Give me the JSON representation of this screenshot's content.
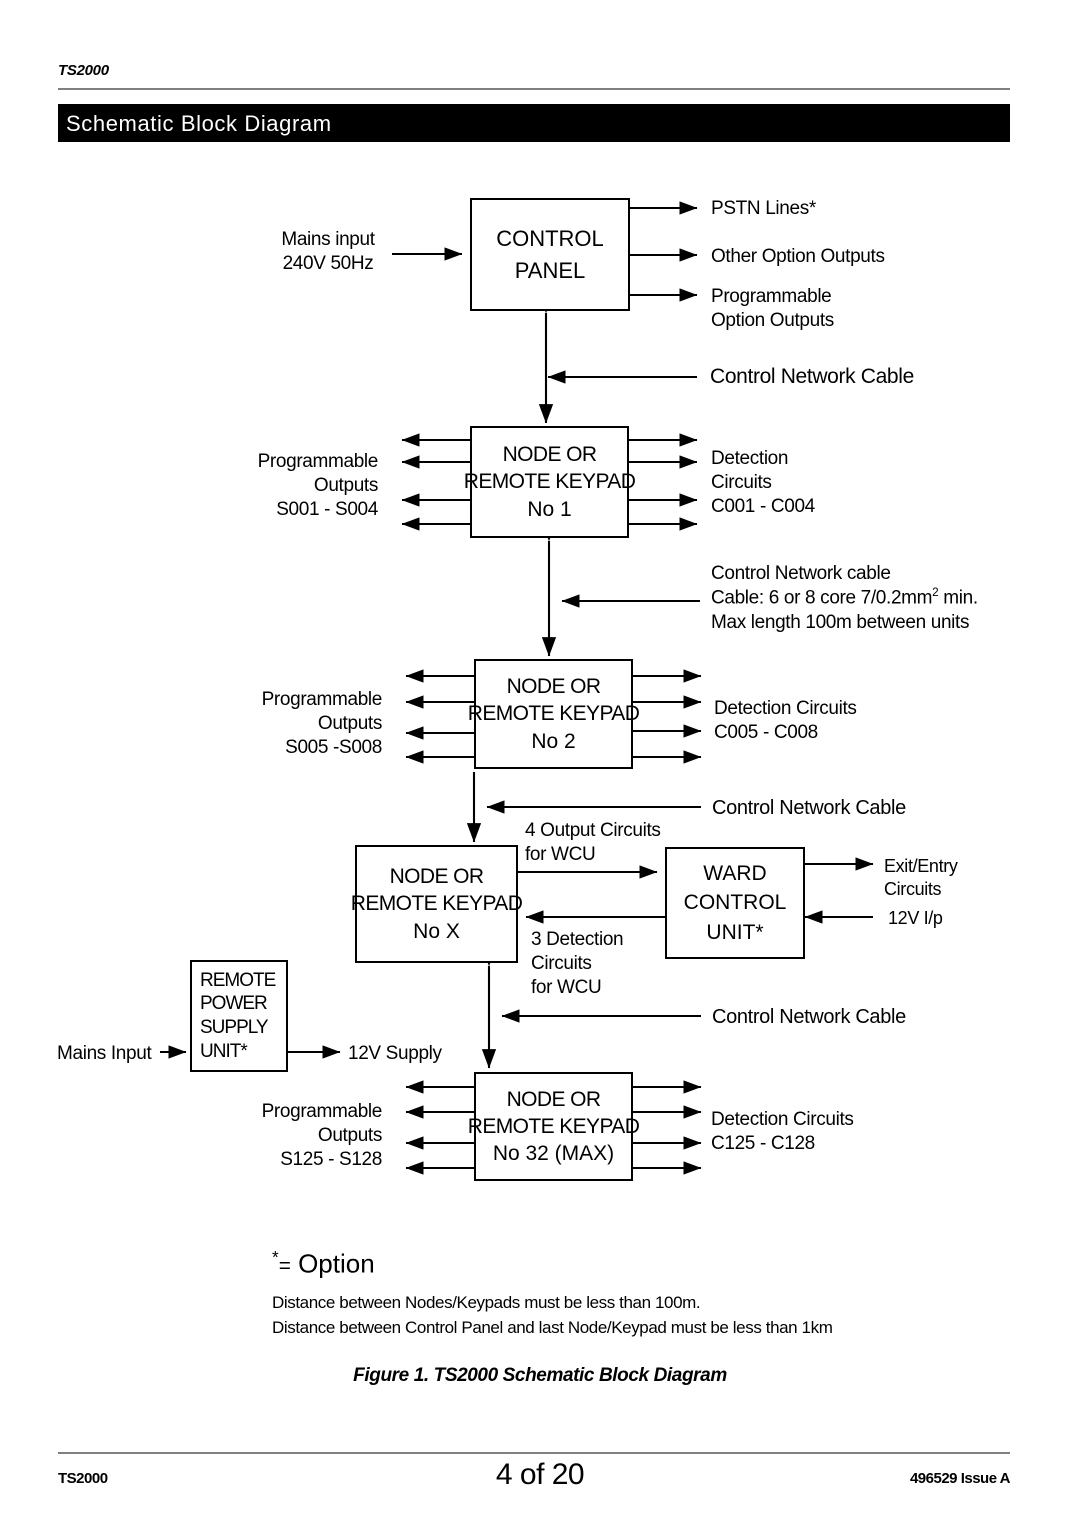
{
  "header": {
    "doc_id": "TS2000",
    "title": "Schematic Block Diagram"
  },
  "blocks": {
    "control_panel": {
      "line1": "CONTROL",
      "line2": "PANEL"
    },
    "node_1": {
      "line1": "NODE OR",
      "line2": "REMOTE KEYPAD",
      "line3": "No  1"
    },
    "node_2": {
      "line1": "NODE OR",
      "line2": "REMOTE KEYPAD",
      "line3": "No  2"
    },
    "node_x": {
      "line1": "NODE OR",
      "line2": "REMOTE KEYPAD",
      "line3": "No  X"
    },
    "node_32": {
      "line1": "NODE OR",
      "line2": "REMOTE KEYPAD",
      "line3": "No 32 (MAX)"
    },
    "ward_control_unit": {
      "line1": "WARD",
      "line2": "CONTROL",
      "line3": "UNIT*"
    },
    "remote_power_supply": {
      "line1": "REMOTE",
      "line2": "POWER",
      "line3": "SUPPLY",
      "line4": "UNIT*"
    }
  },
  "labels": {
    "mains_input_l1": "Mains input",
    "mains_input_l2": "240V 50Hz",
    "pstn_lines": "PSTN Lines*",
    "other_option_outputs": "Other Option Outputs",
    "programmable_option_l1": "Programmable",
    "programmable_option_l2": "Option Outputs",
    "control_network_cable_1": "Control Network Cable",
    "prog_out_1_l1": "Programmable",
    "prog_out_1_l2": "Outputs",
    "prog_out_1_l3": "S001 - S004",
    "detection_1_l1": "Detection",
    "detection_1_l2": "Circuits",
    "detection_1_l3": "C001 - C004",
    "cable_spec_l1": "Control Network cable",
    "cable_spec_l2_a": "Cable: 6 or 8 core 7/0.2mm",
    "cable_spec_l2_sup": "2",
    "cable_spec_l2_b": " min.",
    "cable_spec_l3": "Max length 100m between units",
    "prog_out_2_l1": "Programmable",
    "prog_out_2_l2": "Outputs",
    "prog_out_2_l3": "S005 -S008",
    "detection_2_l1": "Detection Circuits",
    "detection_2_l2": "C005 - C008",
    "control_network_cable_2": "Control Network Cable",
    "wcu_out_l1": "4 Output Circuits",
    "wcu_out_l2": "for WCU",
    "wcu_in_l1": "3 Detection",
    "wcu_in_l2": "Circuits",
    "wcu_in_l3": "for WCU",
    "exit_entry_l1": "Exit/Entry",
    "exit_entry_l2": "Circuits",
    "twelve_v_ip": "12V I/p",
    "mains_input_rpsu": "Mains Input",
    "twelve_v_supply": "12V Supply",
    "control_network_cable_3": "Control Network Cable",
    "prog_out_32_l1": "Programmable",
    "prog_out_32_l2": "Outputs",
    "prog_out_32_l3": "S125 - S128",
    "detection_32_l1": "Detection Circuits",
    "detection_32_l2": "C125 - C128"
  },
  "notes": {
    "option_star": "*",
    "option_eq": "=",
    "option_word": "Option",
    "distance_1": "Distance between Nodes/Keypads must be less than 100m.",
    "distance_2": "Distance between Control Panel and last Node/Keypad must be less than 1km"
  },
  "figure": {
    "caption": "Figure 1.  TS2000 Schematic Block Diagram"
  },
  "footer": {
    "left": "TS2000",
    "center": "4 of 20",
    "right": "496529 Issue A"
  },
  "colors": {
    "banner_bg": "#000000",
    "banner_text": "#ffffff",
    "rule": "#808080",
    "line": "#000000"
  }
}
